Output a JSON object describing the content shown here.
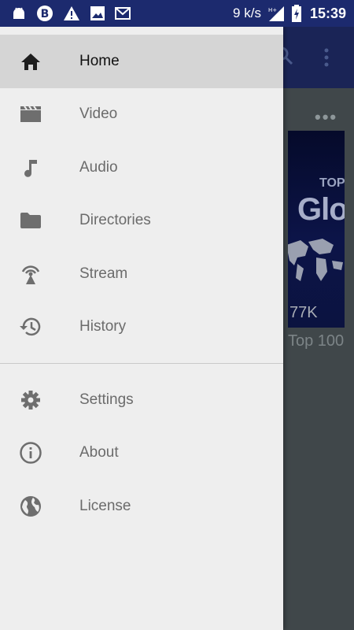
{
  "status_bar": {
    "network_speed": "9 k/s",
    "time": "15:39",
    "icons": [
      "android-icon",
      "b-circle-icon",
      "warning-icon",
      "image-icon",
      "email-icon",
      "signal-icon",
      "battery-icon"
    ]
  },
  "drawer": {
    "primary_items": [
      {
        "label": "Home",
        "icon": "home-icon",
        "selected": true
      },
      {
        "label": "Video",
        "icon": "video-icon",
        "selected": false
      },
      {
        "label": "Audio",
        "icon": "music-note-icon",
        "selected": false
      },
      {
        "label": "Directories",
        "icon": "folder-icon",
        "selected": false
      },
      {
        "label": "Stream",
        "icon": "stream-icon",
        "selected": false
      },
      {
        "label": "History",
        "icon": "history-icon",
        "selected": false
      }
    ],
    "secondary_items": [
      {
        "label": "Settings",
        "icon": "gear-icon"
      },
      {
        "label": "About",
        "icon": "info-icon"
      },
      {
        "label": "License",
        "icon": "globe-icon"
      }
    ]
  },
  "background": {
    "more_glyph": "•••",
    "thumbnail": {
      "text_top": "TOP",
      "text_main": "Glo",
      "views": "77K"
    },
    "caption": "Top 100"
  },
  "colors": {
    "status_bar": "#1c2a6e",
    "drawer_bg": "#eeeeee",
    "selected_bg": "#d5d5d5",
    "icon_gray": "#6e6e6e"
  }
}
